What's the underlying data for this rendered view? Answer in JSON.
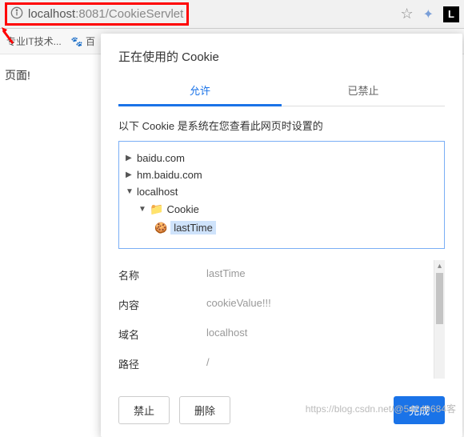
{
  "address_bar": {
    "url_host": "localhost",
    "url_rest": ":8081/CookieServlet"
  },
  "bookmarks": {
    "item1": "专业IT技术...",
    "item2": "百"
  },
  "page": {
    "text": "页面!"
  },
  "dialog": {
    "title": "正在使用的 Cookie",
    "tabs": {
      "allowed": "允许",
      "blocked": "已禁止"
    },
    "description": "以下 Cookie 是系统在您查看此网页时设置的",
    "tree": {
      "site1": "baidu.com",
      "site2": "hm.baidu.com",
      "site3": "localhost",
      "folder": "Cookie",
      "cookie": "lastTime"
    },
    "details": {
      "name_label": "名称",
      "name_value": "lastTime",
      "content_label": "内容",
      "content_value": "cookieValue!!!",
      "domain_label": "域名",
      "domain_value": "localhost",
      "path_label": "路径",
      "path_value": "/"
    },
    "buttons": {
      "block": "禁止",
      "delete": "删除",
      "done": "完成"
    }
  },
  "watermark": "https://blog.csdn.net/@54249684客"
}
